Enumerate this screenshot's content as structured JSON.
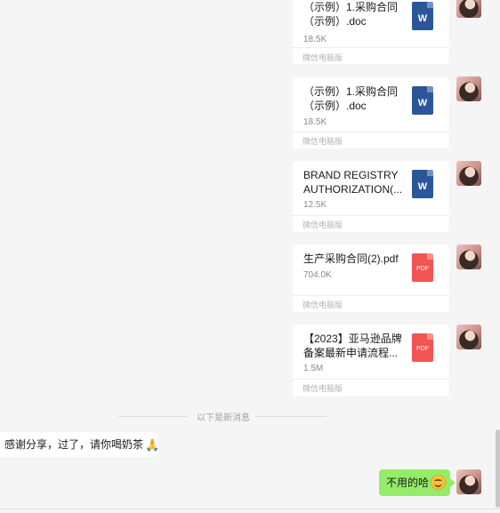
{
  "files": [
    {
      "name": "（示例）1.采购合同\n（示例）.doc",
      "size": "18.5K",
      "source": "微信电脑版",
      "icon": "word-icon",
      "icon_label": "W"
    },
    {
      "name": "（示例）1.采购合同\n（示例）.doc",
      "size": "18.5K",
      "source": "微信电脑版",
      "icon": "word-icon",
      "icon_label": "W"
    },
    {
      "name": "BRAND REGISTRY\nAUTHORIZATION(...",
      "size": "12.5K",
      "source": "微信电脑版",
      "icon": "word-icon",
      "icon_label": "W"
    },
    {
      "name": "生产采购合同(2).pdf",
      "size": "704.0K",
      "source": "微信电脑版",
      "icon": "pdf-icon",
      "icon_label": "PDF"
    },
    {
      "name": "【2023】亚马逊品牌\n备案最新申请流程...",
      "size": "1.5M",
      "source": "微信电脑版",
      "icon": "pdf-icon",
      "icon_label": "PDF"
    }
  ],
  "divider": {
    "label": "以下是新消息"
  },
  "messages": {
    "incoming": {
      "text": "感谢分享，过了，请你喝奶茶",
      "emoji": "🙏"
    },
    "outgoing": {
      "text": "不用的哈",
      "emoji": "smile-emoji",
      "bubble_color": "#95ec69"
    }
  }
}
